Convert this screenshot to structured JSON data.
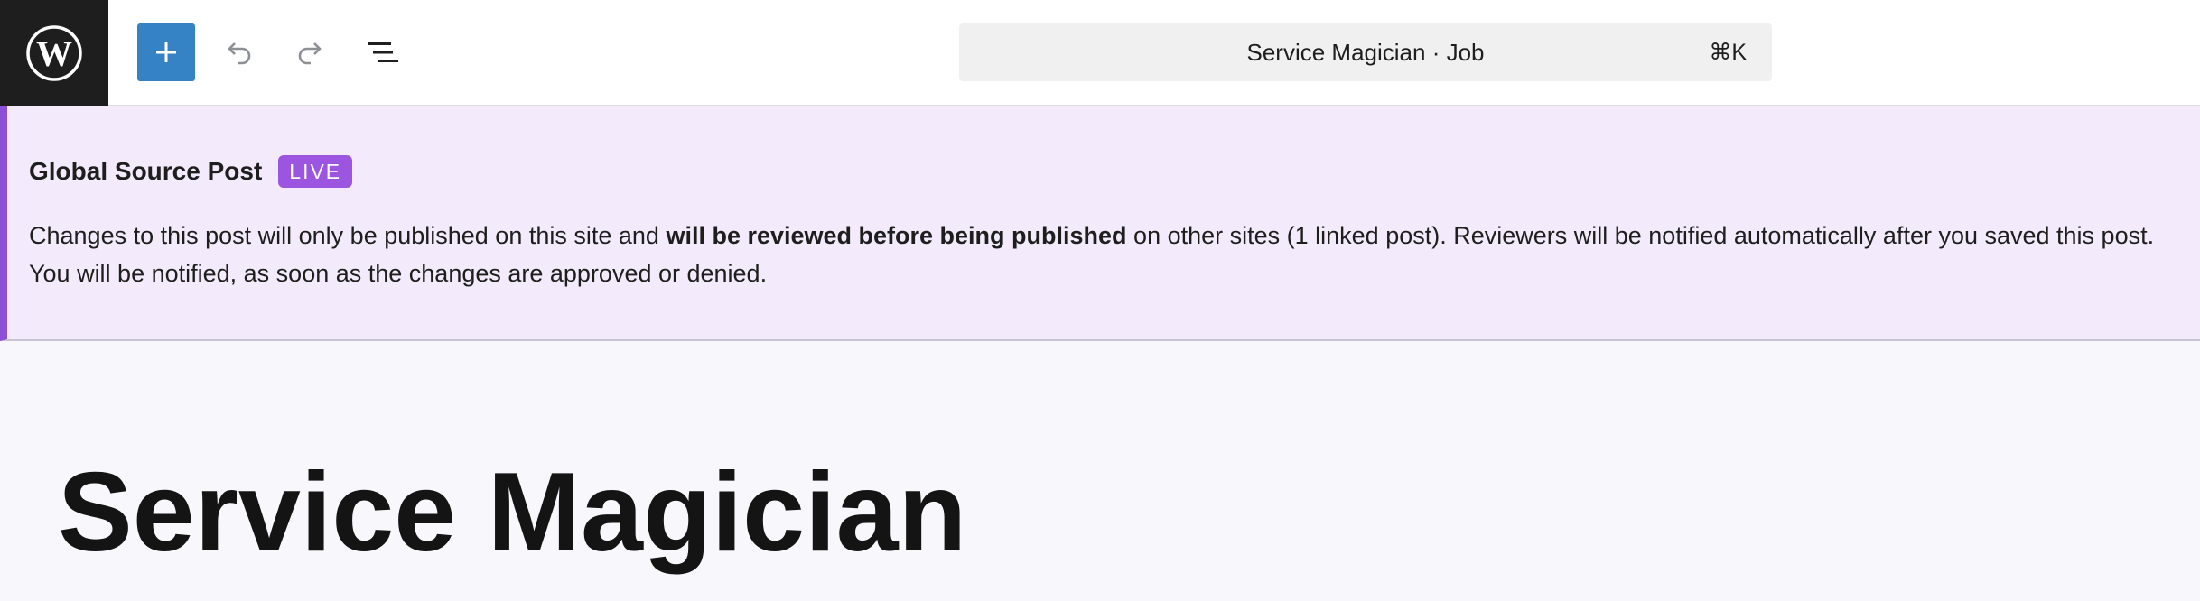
{
  "toolbar": {
    "logo_icon": "wordpress-logo-icon",
    "add_icon": "plus-icon",
    "undo_icon": "undo-icon",
    "redo_icon": "redo-icon",
    "list_view_icon": "list-view-icon",
    "command_bar": {
      "title": "Service Magician · Job",
      "shortcut": "⌘K"
    },
    "colors": {
      "logo_bg": "#1e1e1e",
      "add_button_bg": "#3582c4"
    }
  },
  "notice": {
    "title": "Global Source Post",
    "badge": "LIVE",
    "body_before_bold": "Changes to this post will only be published on this site and ",
    "body_bold": "will be reviewed before being published",
    "body_after_bold": " on other sites (1 linked post). Reviewers will be notified automatically after you saved this post. You will be notified, as soon as the changes are approved or denied.",
    "colors": {
      "background": "#f3ebfb",
      "accent": "#8c4fd8",
      "badge_bg": "#9b55e0"
    }
  },
  "editor": {
    "post_title": "Service Magician"
  }
}
